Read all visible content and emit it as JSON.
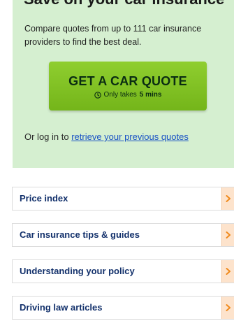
{
  "hero": {
    "heading": "Save on your car insurance",
    "description": "Compare quotes from up to 111 car insurance providers to find the best deal.",
    "quote_button": {
      "label": "GET A CAR QUOTE",
      "sub_prefix": "Only takes",
      "sub_bold": "5 mins"
    },
    "login_prefix": "Or log in to",
    "login_link": "retrieve your previous quotes"
  },
  "nav": {
    "items": [
      {
        "label": "Price index"
      },
      {
        "label": "Car insurance tips & guides"
      },
      {
        "label": "Understanding your policy"
      },
      {
        "label": "Driving law articles"
      }
    ]
  },
  "colors": {
    "hero_bg": "#d5efd0",
    "button_green": "#7dbf22",
    "link_blue": "#1a53c5",
    "nav_text": "#12306b",
    "arrow_orange": "#f08a1c"
  },
  "icons": {
    "clock": "clock-icon",
    "chevron": "chevron-right-icon"
  }
}
